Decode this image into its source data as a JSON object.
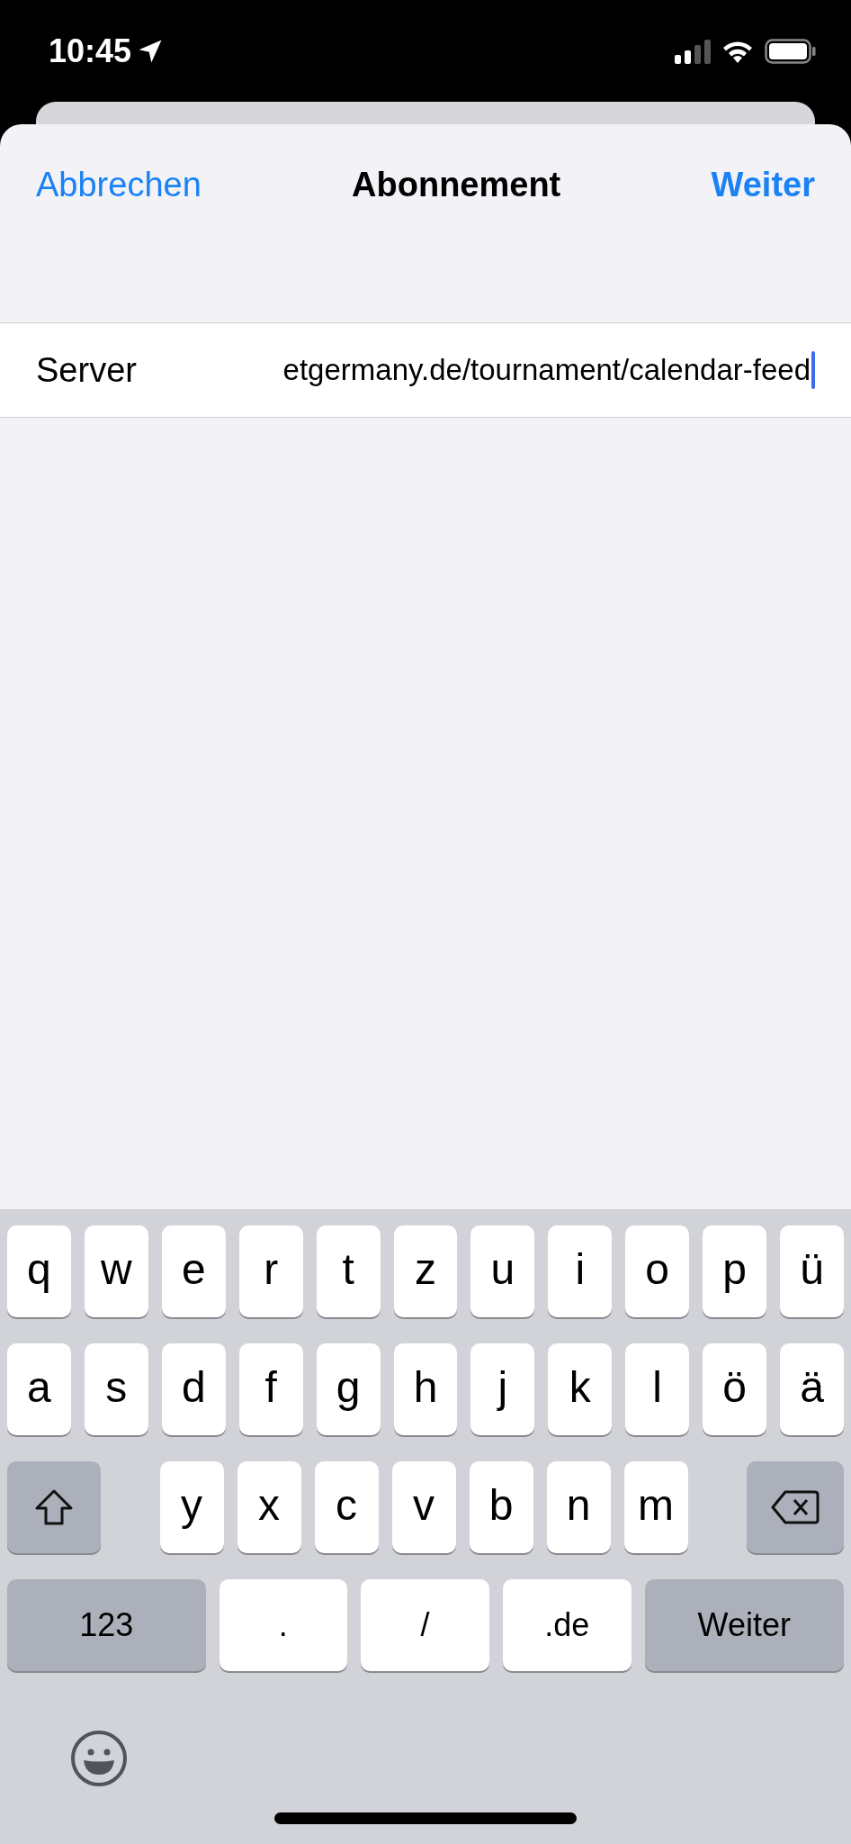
{
  "status_bar": {
    "time": "10:45"
  },
  "nav": {
    "cancel": "Abbrechen",
    "title": "Abonnement",
    "next": "Weiter"
  },
  "form": {
    "label": "Server",
    "value": "etgermany.de/tournament/calendar-feed",
    "focused": true
  },
  "keyboard": {
    "rows": [
      {
        "keys": [
          {
            "label": "q",
            "kind": "letter"
          },
          {
            "label": "w",
            "kind": "letter"
          },
          {
            "label": "e",
            "kind": "letter"
          },
          {
            "label": "r",
            "kind": "letter"
          },
          {
            "label": "t",
            "kind": "letter"
          },
          {
            "label": "z",
            "kind": "letter"
          },
          {
            "label": "u",
            "kind": "letter"
          },
          {
            "label": "i",
            "kind": "letter"
          },
          {
            "label": "o",
            "kind": "letter"
          },
          {
            "label": "p",
            "kind": "letter"
          },
          {
            "label": "ü",
            "kind": "letter"
          }
        ]
      },
      {
        "keys": [
          {
            "label": "a",
            "kind": "letter"
          },
          {
            "label": "s",
            "kind": "letter"
          },
          {
            "label": "d",
            "kind": "letter"
          },
          {
            "label": "f",
            "kind": "letter"
          },
          {
            "label": "g",
            "kind": "letter"
          },
          {
            "label": "h",
            "kind": "letter"
          },
          {
            "label": "j",
            "kind": "letter"
          },
          {
            "label": "k",
            "kind": "letter"
          },
          {
            "label": "l",
            "kind": "letter"
          },
          {
            "label": "ö",
            "kind": "letter"
          },
          {
            "label": "ä",
            "kind": "letter"
          }
        ]
      },
      {
        "keys": [
          {
            "kind": "shift"
          },
          {
            "label": "y",
            "kind": "letter"
          },
          {
            "label": "x",
            "kind": "letter"
          },
          {
            "label": "c",
            "kind": "letter"
          },
          {
            "label": "v",
            "kind": "letter"
          },
          {
            "label": "b",
            "kind": "letter"
          },
          {
            "label": "n",
            "kind": "letter"
          },
          {
            "label": "m",
            "kind": "letter"
          },
          {
            "kind": "backspace"
          }
        ]
      },
      {
        "keys": [
          {
            "label": "123",
            "kind": "numbers"
          },
          {
            "label": ".",
            "kind": "char"
          },
          {
            "label": "/",
            "kind": "char"
          },
          {
            "label": ".de",
            "kind": "char"
          },
          {
            "label": "Weiter",
            "kind": "return"
          }
        ]
      }
    ]
  }
}
